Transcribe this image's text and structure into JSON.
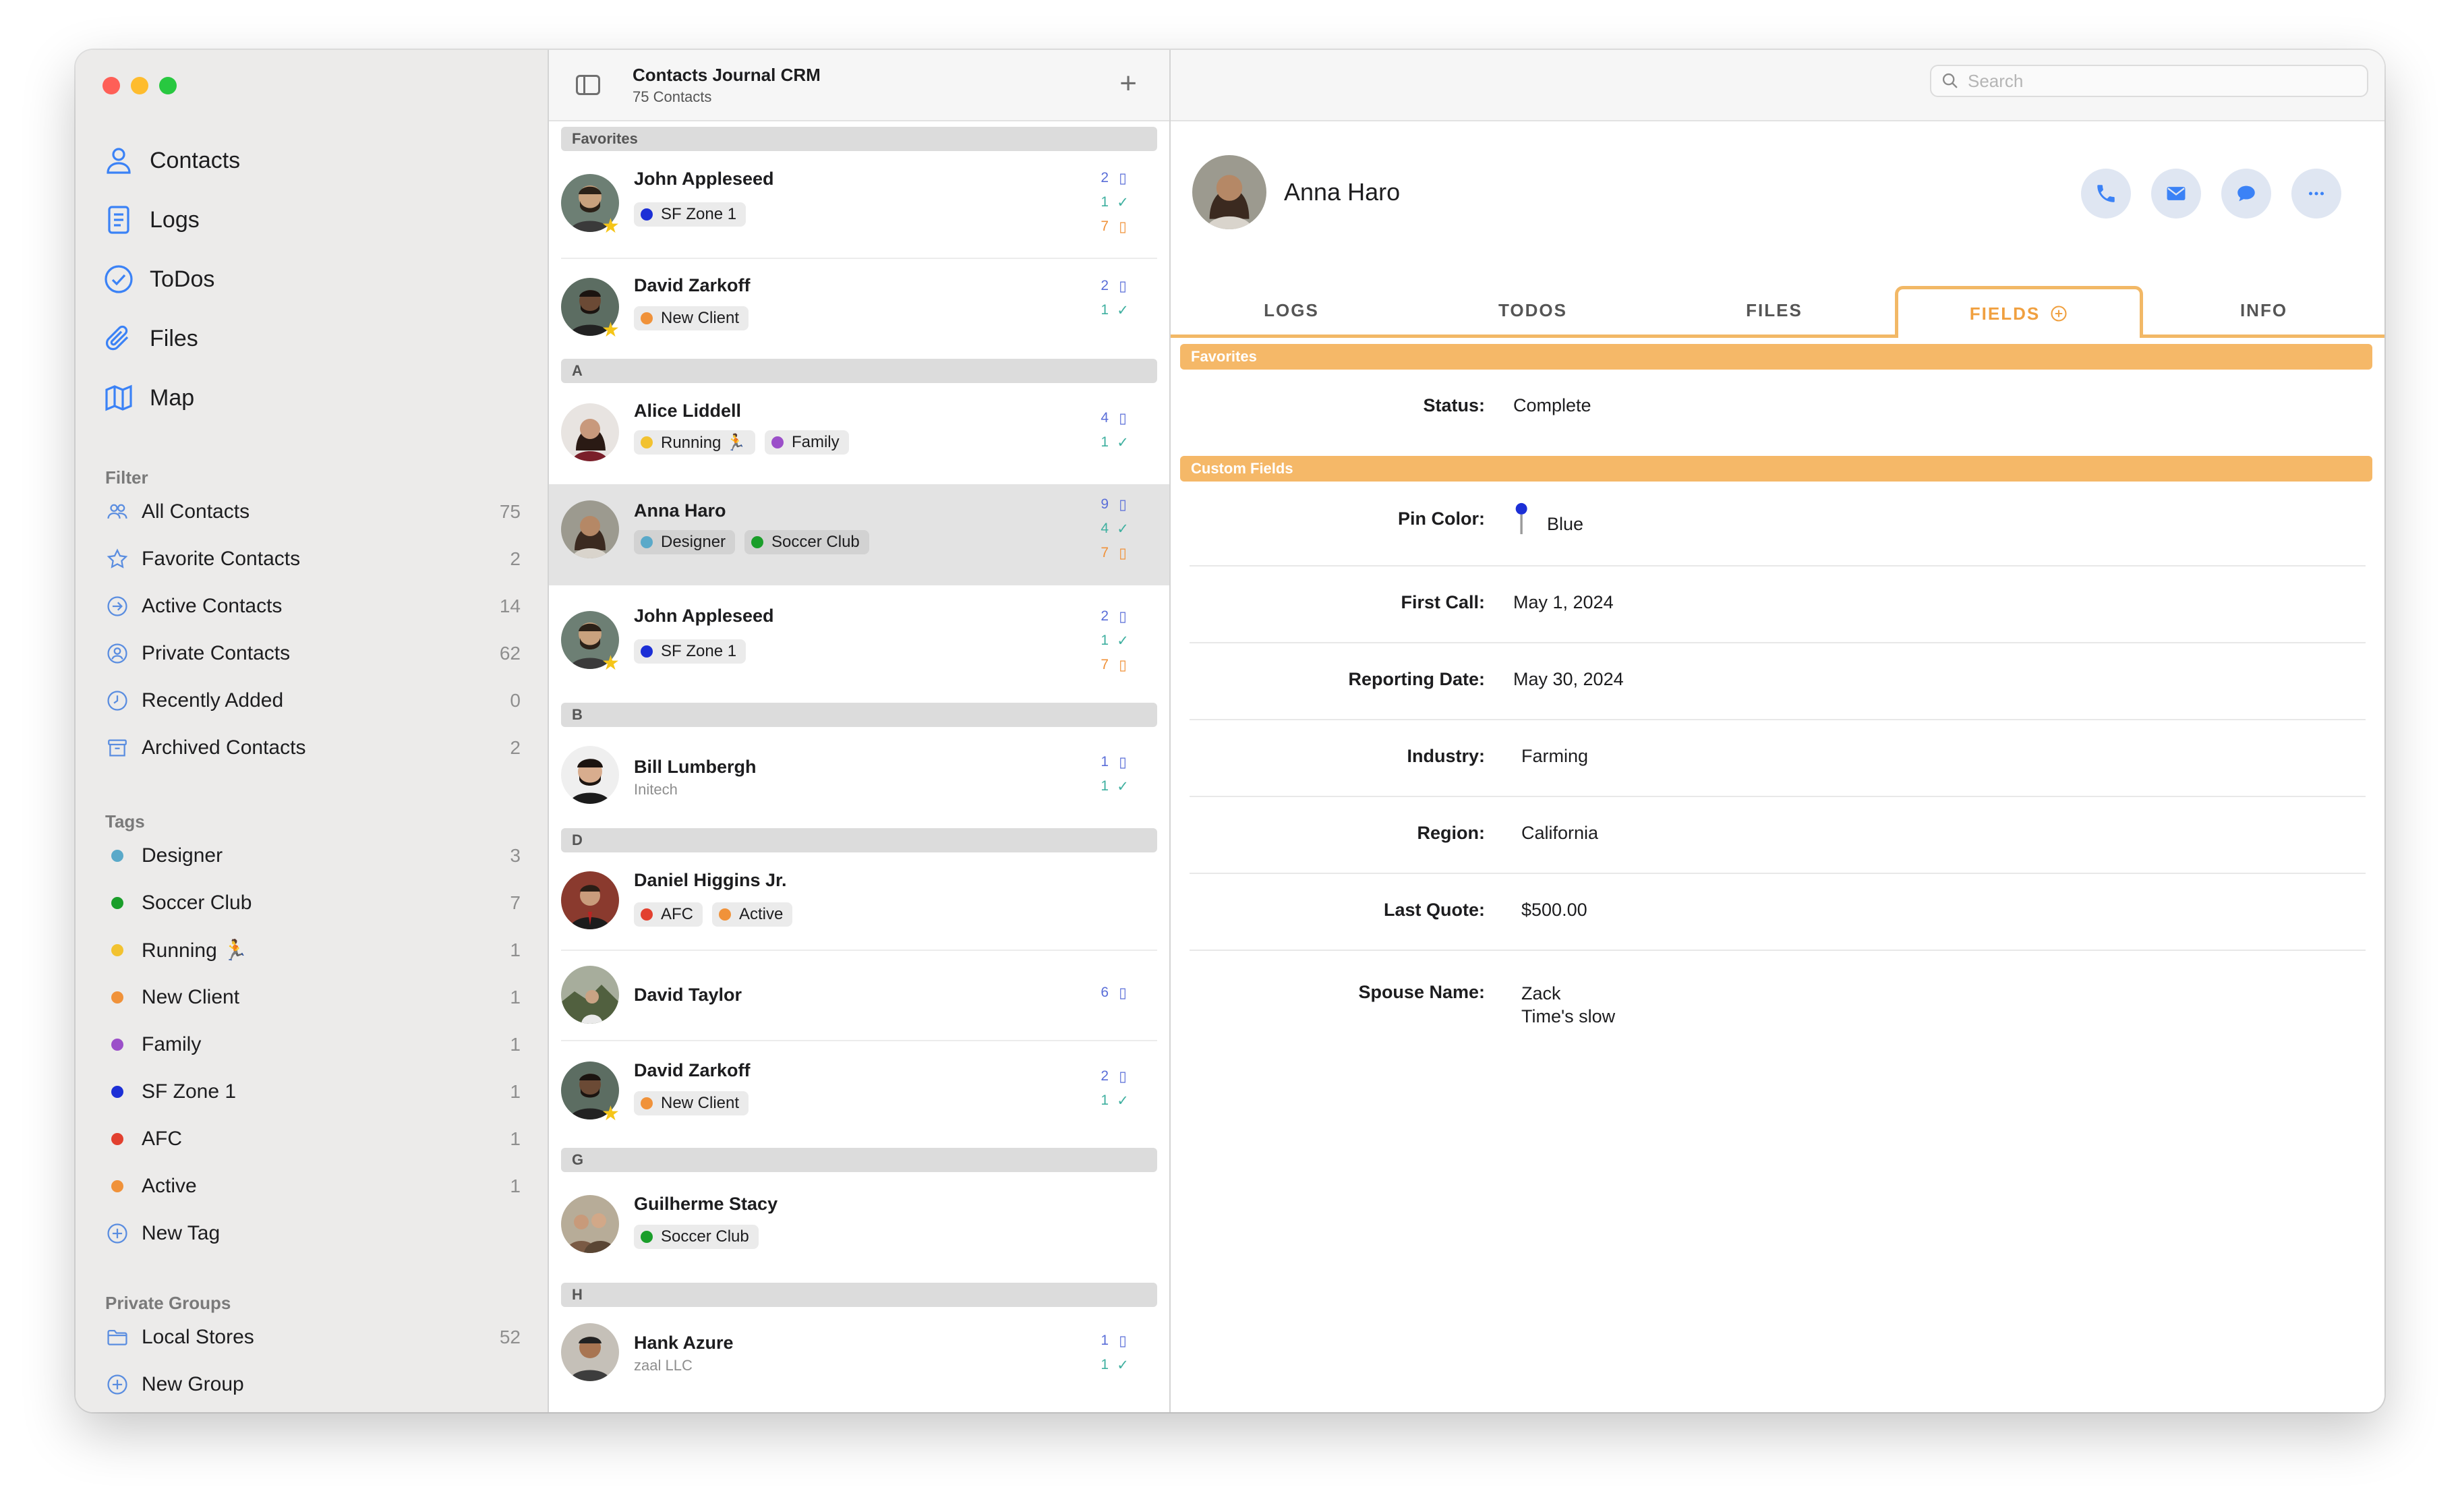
{
  "sidebar": {
    "nav": [
      {
        "label": "Contacts",
        "icon": "person-icon"
      },
      {
        "label": "Logs",
        "icon": "document-icon"
      },
      {
        "label": "ToDos",
        "icon": "checkmark-circle-icon"
      },
      {
        "label": "Files",
        "icon": "paperclip-icon"
      },
      {
        "label": "Map",
        "icon": "map-icon"
      }
    ],
    "filter_title": "Filter",
    "filters": [
      {
        "label": "All Contacts",
        "count": "75",
        "icon": "people-icon"
      },
      {
        "label": "Favorite Contacts",
        "count": "2",
        "icon": "star-icon"
      },
      {
        "label": "Active Contacts",
        "count": "14",
        "icon": "arrow-circle-icon"
      },
      {
        "label": "Private Contacts",
        "count": "62",
        "icon": "person-circle-icon"
      },
      {
        "label": "Recently Added",
        "count": "0",
        "icon": "clock-icon"
      },
      {
        "label": "Archived Contacts",
        "count": "2",
        "icon": "archive-box-icon"
      }
    ],
    "tags_title": "Tags",
    "tags": [
      {
        "label": "Designer",
        "count": "3",
        "color": "#5aa9c9"
      },
      {
        "label": "Soccer Club",
        "count": "7",
        "color": "#1a9e2a"
      },
      {
        "label": "Running 🏃",
        "count": "1",
        "color": "#f2c230"
      },
      {
        "label": "New Client",
        "count": "1",
        "color": "#f0923a"
      },
      {
        "label": "Family",
        "count": "1",
        "color": "#9b4fc9"
      },
      {
        "label": "SF Zone 1",
        "count": "1",
        "color": "#1c2fd6"
      },
      {
        "label": "AFC",
        "count": "1",
        "color": "#e2402f"
      },
      {
        "label": "Active",
        "count": "1",
        "color": "#f0923a"
      }
    ],
    "new_tag": "New Tag",
    "groups_title": "Private Groups",
    "groups": [
      {
        "label": "Local Stores",
        "count": "52"
      }
    ],
    "new_group": "New Group"
  },
  "list": {
    "title": "Contacts Journal CRM",
    "subtitle": "75 Contacts",
    "sections": {
      "favorites": "Favorites",
      "a": "A",
      "b": "B",
      "d": "D",
      "g": "G",
      "h": "H"
    },
    "contacts": [
      {
        "name": "John Appleseed",
        "tags": [
          {
            "label": "SF Zone 1",
            "color": "#1c2fd6"
          }
        ],
        "logs": "2",
        "todos": "1",
        "files": "7"
      },
      {
        "name": "David Zarkoff",
        "tags": [
          {
            "label": "New Client",
            "color": "#f0923a"
          }
        ],
        "logs": "2",
        "todos": "1"
      },
      {
        "name": "Alice Liddell",
        "tags": [
          {
            "label": "Running 🏃",
            "color": "#f2c230"
          },
          {
            "label": "Family",
            "color": "#9b4fc9"
          }
        ],
        "logs": "4",
        "todos": "1"
      },
      {
        "name": "Anna Haro",
        "tags": [
          {
            "label": "Designer",
            "color": "#5aa9c9"
          },
          {
            "label": "Soccer Club",
            "color": "#1a9e2a"
          }
        ],
        "logs": "9",
        "todos": "4",
        "files": "7"
      },
      {
        "name": "John Appleseed",
        "tags": [
          {
            "label": "SF Zone 1",
            "color": "#1c2fd6"
          }
        ],
        "logs": "2",
        "todos": "1",
        "files": "7"
      },
      {
        "name": "Bill Lumbergh",
        "subtitle": "Initech",
        "logs": "1",
        "todos": "1"
      },
      {
        "name": "Daniel Higgins Jr.",
        "tags": [
          {
            "label": "AFC",
            "color": "#e2402f"
          },
          {
            "label": "Active",
            "color": "#f0923a"
          }
        ]
      },
      {
        "name": "David Taylor",
        "logs": "6"
      },
      {
        "name": "David Zarkoff",
        "tags": [
          {
            "label": "New Client",
            "color": "#f0923a"
          }
        ],
        "logs": "2",
        "todos": "1"
      },
      {
        "name": "Guilherme Stacy",
        "tags": [
          {
            "label": "Soccer Club",
            "color": "#1a9e2a"
          }
        ]
      },
      {
        "name": "Hank Azure",
        "subtitle": "zaal LLC",
        "logs": "1",
        "todos": "1"
      }
    ]
  },
  "detail": {
    "search_placeholder": "Search",
    "name": "Anna Haro",
    "tabs": [
      "LOGS",
      "TODOS",
      "FILES",
      "FIELDS",
      "INFO"
    ],
    "favorites_band": "Favorites",
    "custom_band": "Custom Fields",
    "status": {
      "label": "Status:",
      "value": "Complete"
    },
    "fields": [
      {
        "label": "Pin Color:",
        "value": "Blue"
      },
      {
        "label": "First Call:",
        "value": "May 1, 2024"
      },
      {
        "label": "Reporting Date:",
        "value": "May 30, 2024"
      },
      {
        "label": "Industry:",
        "value": "Farming"
      },
      {
        "label": "Region:",
        "value": "California"
      },
      {
        "label": "Last Quote:",
        "value": "$500.00"
      },
      {
        "label": "Spouse Name:",
        "value": "Zack",
        "value2": "Time's slow"
      }
    ]
  }
}
